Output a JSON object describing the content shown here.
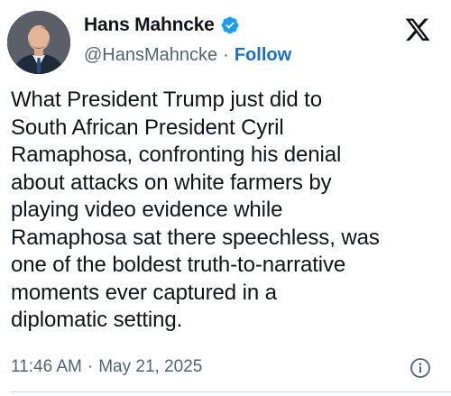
{
  "author": {
    "display_name": "Hans Mahncke",
    "handle": "@HansMahncke",
    "separator": "·",
    "follow_label": "Follow",
    "verified": true
  },
  "tweet": {
    "text": "What President Trump just did to\nSouth African President Cyril\nRamaphosa, confronting his denial\nabout attacks on white farmers by\nplaying video evidence while\nRamaphosa sat there speechless, was\none of the boldest truth-to-narrative\nmoments ever captured in a\ndiplomatic setting."
  },
  "meta": {
    "time": "11:46 AM",
    "separator": "·",
    "date": "May 21, 2025"
  },
  "colors": {
    "verified_badge": "#1d9bf0",
    "follow_link": "#1d6fc4",
    "secondary_text": "#536471",
    "primary_text": "#0f1419"
  },
  "icons": {
    "verified": "verified-badge-icon",
    "platform": "x-logo-icon",
    "info": "info-icon"
  }
}
